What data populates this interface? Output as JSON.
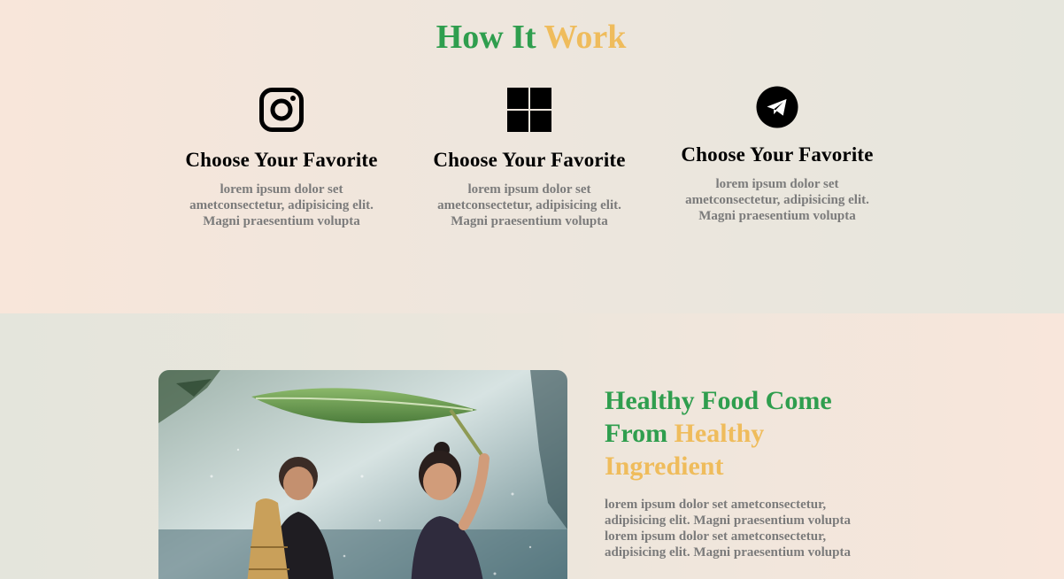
{
  "how_section": {
    "title_part1": "How It",
    "title_part2": "Work",
    "steps": [
      {
        "icon": "instagram-icon",
        "title": "Choose Your Favorite",
        "desc": "lorem ipsum dolor set ametconsectetur, adipisicing elit. Magni praesentium volupta"
      },
      {
        "icon": "windows-icon",
        "title": "Choose Your Favorite",
        "desc": "lorem ipsum dolor set ametconsectetur, adipisicing elit. Magni praesentium volupta"
      },
      {
        "icon": "telegram-icon",
        "title": "Choose Your Favorite",
        "desc": "lorem ipsum dolor set ametconsectetur, adipisicing elit. Magni praesentium volupta"
      }
    ]
  },
  "healthy_section": {
    "title_part1": "Healthy Food Come From",
    "title_part2": "Healthy Ingredient",
    "desc": "lorem ipsum dolor set ametconsectetur, adipisicing elit. Magni praesentium volupta lorem ipsum dolor set ametconsectetur, adipisicing elit. Magni praesentium volupta"
  },
  "colors": {
    "accent_green": "#2f9e4e",
    "accent_gold": "#efbc5c",
    "text_gray": "#7b7b7b"
  }
}
